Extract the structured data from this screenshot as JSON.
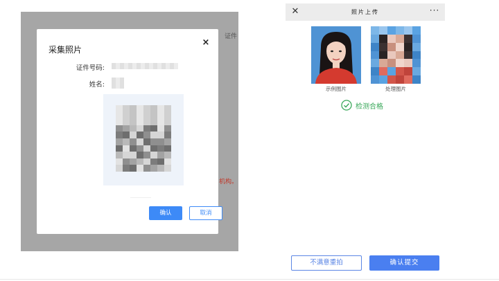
{
  "desktop": {
    "background_peek": {
      "top_text": "证件",
      "red_text": "机构。"
    },
    "modal": {
      "title": "采集照片",
      "close_label": "×",
      "id_number_label": "证件号码:",
      "name_label": "姓名:",
      "confirm_label": "确认",
      "cancel_label": "取消"
    }
  },
  "mobile": {
    "header": {
      "title": "照片上传",
      "close_label": "✕",
      "more_label": "···"
    },
    "sample_caption": "示例图片",
    "processed_caption": "处理图片",
    "check_status": "检测合格",
    "retake_label": "不满意重拍",
    "submit_label": "确认提交",
    "colors": {
      "accent": "#4a7ff0",
      "success": "#3aa85a",
      "photo_background": "#4f93d4"
    },
    "icons": {
      "check": "check-circle-icon",
      "close": "close-icon",
      "more": "more-dots-icon"
    }
  }
}
